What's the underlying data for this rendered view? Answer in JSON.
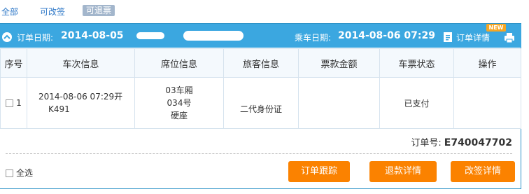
{
  "filters": {
    "all": "全部",
    "changeable": "可改签",
    "refundable": "可退票"
  },
  "order_header": {
    "order_date_label": "订单日期:",
    "order_date_value": "2014-08-05",
    "ride_date_label": "乘车日期:",
    "ride_date_value": "2014-08-06 07:29",
    "detail_link": "订单详情",
    "new_badge": "NEW"
  },
  "table": {
    "headers": [
      "序号",
      "车次信息",
      "席位信息",
      "旅客信息",
      "票款金额",
      "车票状态",
      "操作"
    ],
    "rows": [
      {
        "index": "1",
        "train_departure": "2014-08-06 07:29开",
        "train_number": "K491",
        "seat_car": "03车厢",
        "seat_number": "034号",
        "seat_class": "硬座",
        "passenger_id_type": "二代身份证",
        "amount": "",
        "status": "已支付",
        "action": ""
      }
    ]
  },
  "order_number": {
    "label": "订单号:",
    "value": "E740047702"
  },
  "footer": {
    "select_all": "全选",
    "btn_track": "订单跟踪",
    "btn_refund_detail": "退款详情",
    "btn_change_detail": "改签详情"
  },
  "colors": {
    "header_blue": "#3ba7e0",
    "button_orange": "#fb8200",
    "link_blue": "#2d77c7"
  }
}
